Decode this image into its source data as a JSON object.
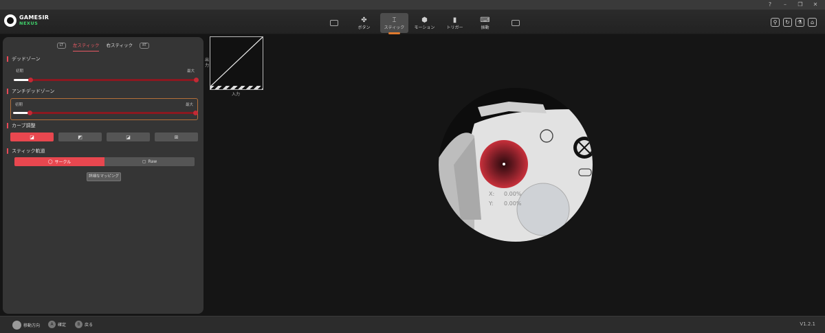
{
  "window_controls": [
    "?",
    "–",
    "❐",
    "✕"
  ],
  "brand": {
    "name": "GAMESIR",
    "sub": "NEXUS"
  },
  "nav_tabs": [
    {
      "label": "",
      "icon": "controller-icon"
    },
    {
      "label": "ボタン",
      "icon": "buttons-icon"
    },
    {
      "label": "スティック",
      "icon": "stick-icon"
    },
    {
      "label": "モーション",
      "icon": "motion-icon"
    },
    {
      "label": "トリガー",
      "icon": "trigger-icon"
    },
    {
      "label": "振動",
      "icon": "vibration-icon"
    },
    {
      "label": "",
      "icon": "controller-alt-icon"
    }
  ],
  "header_icons": [
    "person-icon",
    "refresh-icon",
    "flask-icon",
    "home-icon"
  ],
  "stick_tabs": {
    "left_chip": "LT",
    "left": "左スティック",
    "right": "右スティック",
    "right_chip": "RT"
  },
  "deadzone": {
    "title": "デッドゾーン",
    "min_label": "初期",
    "max_label": "最大",
    "start_value": 0.09,
    "end_value": 1.0
  },
  "anti_deadzone": {
    "title": "アンチデッドゾーン",
    "min_label": "初期",
    "max_label": "最大",
    "start_value": 0.09,
    "end_value": 1.0
  },
  "curve": {
    "title": "カーブ調整",
    "options": [
      "linear-curve-icon",
      "curve-2-icon",
      "curve-3-icon",
      "curve-4-icon"
    ]
  },
  "trajectory": {
    "title": "スティック軌道",
    "options": [
      "サークル",
      "Raw"
    ]
  },
  "mapping_button": "詳細なマッピング",
  "graph": {
    "ylabel": "出力",
    "xlabel": "入力"
  },
  "readout": {
    "x_label": "X:",
    "x_value": "0.00%",
    "y_label": "Y:",
    "y_value": "0.00%"
  },
  "footer": {
    "hints": [
      {
        "key": "",
        "label": "移動方向"
      },
      {
        "key": "A",
        "label": "確定"
      },
      {
        "key": "B",
        "label": "戻る"
      }
    ],
    "version": "V1.2.1"
  },
  "colors": {
    "accent": "#e8474f",
    "active_underline": "#e07a2e",
    "track": "#8c1820"
  }
}
